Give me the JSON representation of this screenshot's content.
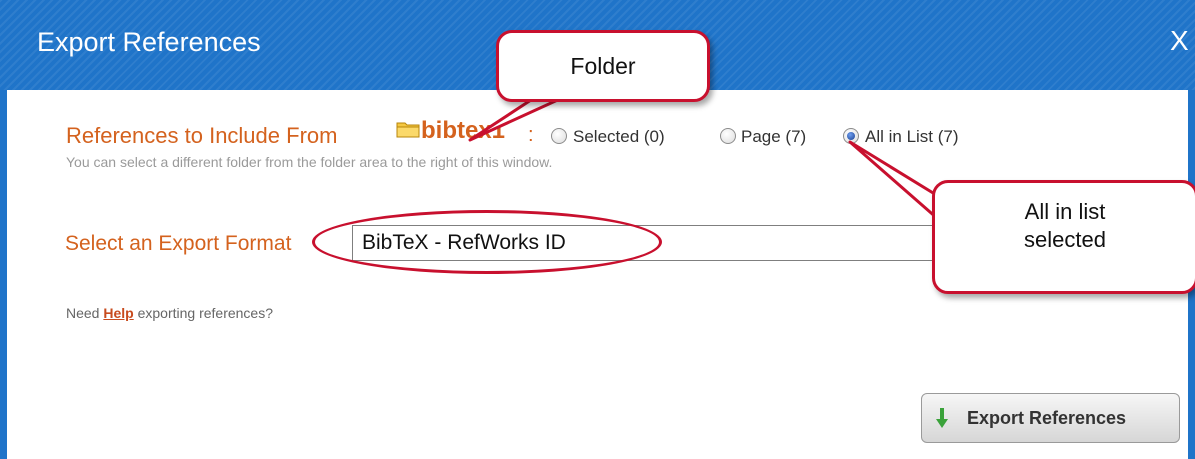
{
  "dialog": {
    "title": "Export References",
    "close_label": "X"
  },
  "references": {
    "label": "References to Include From",
    "folder_name": "bibtex1",
    "colon": ":",
    "options": [
      {
        "label": "Selected (0)",
        "checked": false
      },
      {
        "label": "Page (7)",
        "checked": false
      },
      {
        "label": "All in List (7)",
        "checked": true
      }
    ],
    "hint": "You can select a different folder from the folder area to the right of this window."
  },
  "format": {
    "label": "Select an Export Format",
    "selected_value": "BibTeX - RefWorks ID"
  },
  "help": {
    "prefix": "Need",
    "link_text": "Help",
    "suffix": "exporting references?"
  },
  "export_button": {
    "label": "Export References"
  },
  "callouts": {
    "folder": "Folder",
    "all_in_list": "All in list selected"
  },
  "colors": {
    "titlebar": "#1f74c9",
    "accent_orange": "#d4621e",
    "annotation_red": "#c8102e"
  },
  "icons": {
    "folder": "folder-icon",
    "export_arrow": "arrow-down-icon"
  }
}
